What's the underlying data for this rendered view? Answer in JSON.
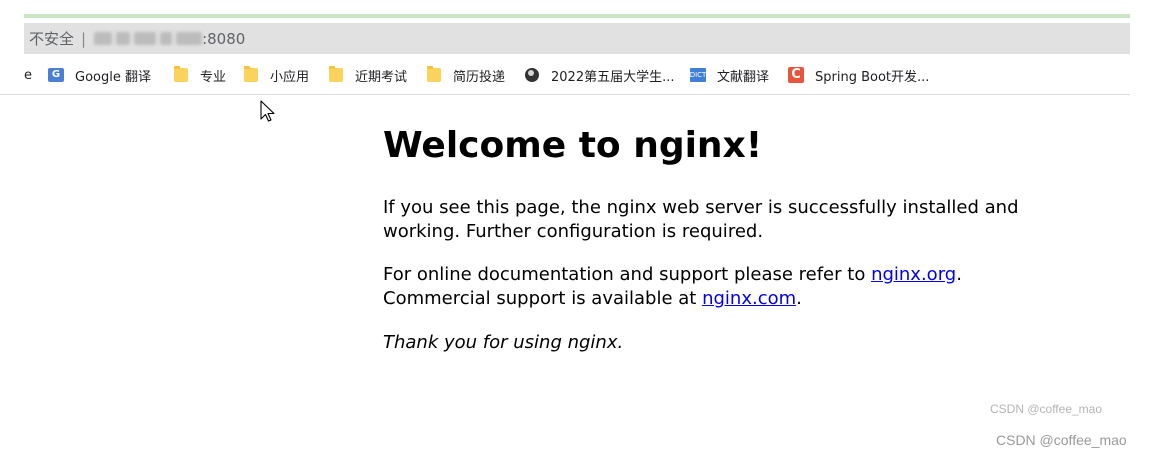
{
  "browser": {
    "address": {
      "security_label": "不安全",
      "separator": "|",
      "port": ":8080"
    },
    "bookmarks": [
      {
        "label": "e",
        "icon": "partial-icon"
      },
      {
        "label": "Google 翻译",
        "icon": "google-translate-icon"
      },
      {
        "label": "专业",
        "icon": "folder-icon"
      },
      {
        "label": "小应用",
        "icon": "folder-icon"
      },
      {
        "label": "近期考试",
        "icon": "folder-icon"
      },
      {
        "label": "简历投递",
        "icon": "folder-icon"
      },
      {
        "label": "2022第五届大学生...",
        "icon": "globe-icon"
      },
      {
        "label": "文献翻译",
        "icon": "dictionary-icon"
      },
      {
        "label": "Spring Boot开发...",
        "icon": "csdn-icon"
      }
    ]
  },
  "page": {
    "heading": "Welcome to nginx!",
    "p1": "If you see this page, the nginx web server is successfully installed and working. Further configuration is required.",
    "p2_pre": "For online documentation and support please refer to ",
    "p2_link1": "nginx.org",
    "p2_mid": ".",
    "p2_line2_pre": "Commercial support is available at ",
    "p2_link2": "nginx.com",
    "p2_end": ".",
    "p3": "Thank you for using nginx."
  },
  "watermarks": {
    "inner": "CSDN @coffee_mao",
    "outer": "CSDN @coffee_mao"
  },
  "colors": {
    "link": "#0000ee",
    "address_bar": "#e1e1e1",
    "top_accent": "#c9e7c2"
  }
}
